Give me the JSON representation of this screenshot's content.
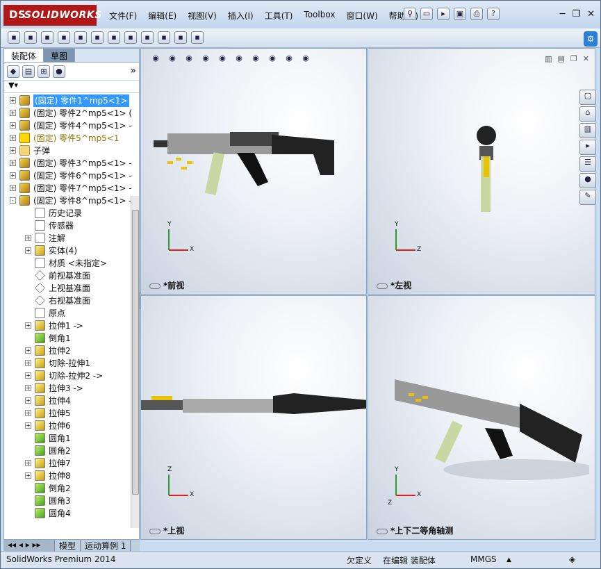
{
  "app": {
    "logo": "SOLIDWORKS",
    "logo_mark": "DS"
  },
  "menu": [
    "文件(F)",
    "编辑(E)",
    "视图(V)",
    "插入(I)",
    "工具(T)",
    "Toolbox",
    "窗口(W)",
    "帮助(H)"
  ],
  "left_tabs": [
    "装配体",
    "草图"
  ],
  "tree": [
    {
      "label": "(固定) 零件1^mp5<1>",
      "type": "part",
      "level": 0,
      "exp": "+",
      "selected": true
    },
    {
      "label": "(固定) 零件2^mp5<1> (",
      "type": "part",
      "level": 0,
      "exp": "+"
    },
    {
      "label": "(固定) 零件4^mp5<1> -",
      "type": "part",
      "level": 0,
      "exp": "+"
    },
    {
      "label": "(固定) 零件5^mp5<1",
      "type": "warn",
      "level": 0,
      "exp": "+",
      "warn": true
    },
    {
      "label": "子弹",
      "type": "folder",
      "level": 0,
      "exp": "+"
    },
    {
      "label": "(固定) 零件3^mp5<1> -",
      "type": "part",
      "level": 0,
      "exp": "+"
    },
    {
      "label": "(固定) 零件6^mp5<1> -",
      "type": "part",
      "level": 0,
      "exp": "+"
    },
    {
      "label": "(固定) 零件7^mp5<1> -",
      "type": "part",
      "level": 0,
      "exp": "+"
    },
    {
      "label": "(固定) 零件8^mp5<1> -",
      "type": "part",
      "level": 0,
      "exp": "-"
    },
    {
      "label": "历史记录",
      "type": "doc",
      "level": 1,
      "exp": ""
    },
    {
      "label": "传感器",
      "type": "doc",
      "level": 1,
      "exp": ""
    },
    {
      "label": "注解",
      "type": "doc",
      "level": 1,
      "exp": "+"
    },
    {
      "label": "实体(4)",
      "type": "feat",
      "level": 1,
      "exp": "+"
    },
    {
      "label": "材质 <未指定>",
      "type": "doc",
      "level": 1,
      "exp": ""
    },
    {
      "label": "前视基准面",
      "type": "plane",
      "level": 1,
      "exp": ""
    },
    {
      "label": "上视基准面",
      "type": "plane",
      "level": 1,
      "exp": ""
    },
    {
      "label": "右视基准面",
      "type": "plane",
      "level": 1,
      "exp": ""
    },
    {
      "label": "原点",
      "type": "doc",
      "level": 1,
      "exp": ""
    },
    {
      "label": "拉伸1 ->",
      "type": "feat",
      "level": 1,
      "exp": "+"
    },
    {
      "label": "倒角1",
      "type": "fillet",
      "level": 1,
      "exp": ""
    },
    {
      "label": "拉伸2",
      "type": "feat",
      "level": 1,
      "exp": "+"
    },
    {
      "label": "切除-拉伸1",
      "type": "feat",
      "level": 1,
      "exp": "+"
    },
    {
      "label": "切除-拉伸2 ->",
      "type": "feat",
      "level": 1,
      "exp": "+"
    },
    {
      "label": "拉伸3 ->",
      "type": "feat",
      "level": 1,
      "exp": "+"
    },
    {
      "label": "拉伸4",
      "type": "feat",
      "level": 1,
      "exp": "+"
    },
    {
      "label": "拉伸5",
      "type": "feat",
      "level": 1,
      "exp": "+"
    },
    {
      "label": "拉伸6",
      "type": "feat",
      "level": 1,
      "exp": "+"
    },
    {
      "label": "圆角1",
      "type": "fillet",
      "level": 1,
      "exp": ""
    },
    {
      "label": "圆角2",
      "type": "fillet",
      "level": 1,
      "exp": ""
    },
    {
      "label": "拉伸7",
      "type": "feat",
      "level": 1,
      "exp": "+"
    },
    {
      "label": "拉伸8",
      "type": "feat",
      "level": 1,
      "exp": "+"
    },
    {
      "label": "倒角2",
      "type": "fillet",
      "level": 1,
      "exp": ""
    },
    {
      "label": "圆角3",
      "type": "fillet",
      "level": 1,
      "exp": ""
    },
    {
      "label": "圆角4",
      "type": "fillet",
      "level": 1,
      "exp": ""
    }
  ],
  "bottom_tabs": [
    "模型",
    "运动算例 1"
  ],
  "viewports": [
    {
      "label": "*前视",
      "axes": [
        "Y",
        "X"
      ]
    },
    {
      "label": "*左视",
      "axes": [
        "Y",
        "Z"
      ]
    },
    {
      "label": "*上视",
      "axes": [
        "Z",
        "X"
      ]
    },
    {
      "label": "*上下二等角轴测",
      "axes": [
        "Y",
        "X",
        "Z"
      ]
    }
  ],
  "status": {
    "product": "SolidWorks Premium 2014",
    "state": "欠定义",
    "mode": "在编辑 装配体",
    "units": "MMGS",
    "units_arrow": "▲"
  },
  "colors": {
    "selection": "#3399ff",
    "brand": "#b01717"
  }
}
